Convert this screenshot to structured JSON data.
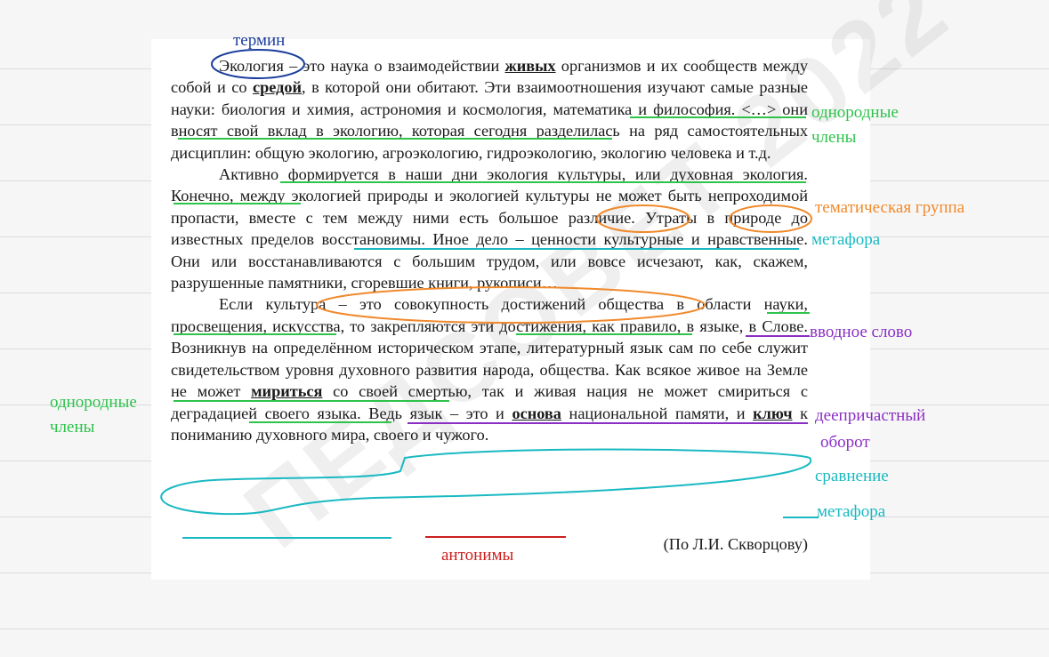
{
  "document": {
    "paragraphs": [
      "Экология – это наука о взаимодействии живых организмов и их сообществ между собой и со средой, в которой они обитают. Эти взаимоотношения изучают самые разные науки: биология и химия, астрономия и космология, математика и философия. <…> они вносят свой вклад в экологию, которая сегодня разделилась на ряд самостоятельных дисциплин: общую экологию, агроэкологию, гидроэкологию, экологию человека и т.д.",
      "Активно формируется в наши дни экология культуры, или духовная экология. Конечно, между экологией природы и экологией культуры не может быть непроходимой пропасти, вместе с тем между ними есть большое различие. Утраты в природе до известных пределов восстановимы. Иное дело – ценности культурные и нравственные. Они или восстанавливаются с большим трудом, или вовсе исчезают, как, скажем, разрушенные памятники, сгоревшие книги, рукописи…",
      "Если культура – это совокупность достижений общества в области науки, просвещения, искусства, то закрепляются эти достижения, как правило, в языке, в Слове. Возникнув на определённом историческом этапе, литературный язык сам по себе служит свидетельством уровня духовного развития народа, общества. Как всякое живое на Земле не может мириться со своей смертью, так и живая нация не может смириться с деградацией своего языка. Ведь язык – это и основа национальной памяти, и ключ к пониманию духовного мира, своего и чужого."
    ],
    "bold_words": [
      "живых",
      "средой",
      "мириться",
      "основа",
      "ключ"
    ],
    "source": "(По Л.И. Скворцову)"
  },
  "annotations": {
    "term": "термин",
    "homogeneous_right_line1": "однородные",
    "homogeneous_right_line2": "члены",
    "thematic_group": "тематическая группа",
    "metaphor_1": "метафора",
    "introductory_word": "вводное слово",
    "homogeneous_left_line1": "однородные",
    "homogeneous_left_line2": "члены",
    "participle_phrase_line1": "деепричастный",
    "participle_phrase_line2": "оборот",
    "comparison": "сравнение",
    "metaphor_2": "метафора",
    "antonyms": "антонимы"
  },
  "colors": {
    "green": "#2ec34a",
    "orange": "#f08a2c",
    "teal": "#1ab9c2",
    "purple": "#8a2fc4",
    "blue": "#1a3c9c",
    "red": "#cc1f1f"
  }
}
